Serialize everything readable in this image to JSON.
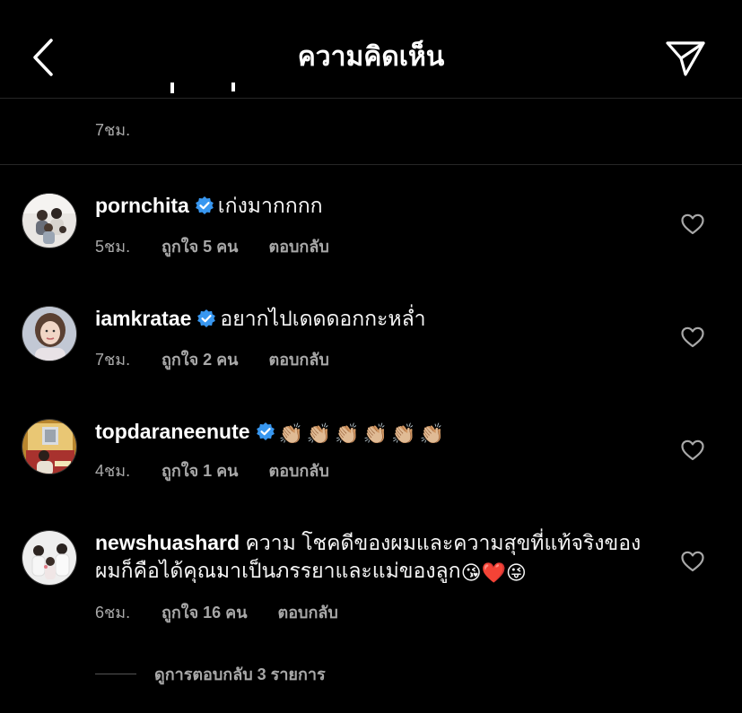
{
  "header": {
    "title": "ความคิดเห็น",
    "back_icon": "chevron-left-icon",
    "send_icon": "paper-plane-icon"
  },
  "previous_comment": {
    "time": "7ชม."
  },
  "colors": {
    "background": "#000000",
    "text": "#f5f5f5",
    "muted": "#a8a8a8",
    "verified": "#3897f0",
    "divider": "#262626"
  },
  "comments": [
    {
      "username": "pornchita",
      "verified": true,
      "text": "เก่งมากกกก",
      "time": "5ชม.",
      "likes": "ถูกใจ 5 คน",
      "reply": "ตอบกลับ"
    },
    {
      "username": "iamkratae",
      "verified": true,
      "text": "อยากไปเดดดอกกะหล่ำ",
      "time": "7ชม.",
      "likes": "ถูกใจ 2 คน",
      "reply": "ตอบกลับ"
    },
    {
      "username": "topdaraneenute",
      "verified": true,
      "text": "👏🏼👏🏼👏🏼👏🏼👏🏼👏🏼",
      "time": "4ชม.",
      "likes": "ถูกใจ 1 คน",
      "reply": "ตอบกลับ"
    },
    {
      "username": "newshuashard",
      "verified": false,
      "text": "ความ โชคดีของผมและความสุขที่แท้จริงของ",
      "text_line2": "ผมก็คือได้คุณมาเป็นภรรยาและแม่ของลูก",
      "emojis": [
        "😘",
        "❤️",
        "😜"
      ],
      "time": "6ชม.",
      "likes": "ถูกใจ 16 คน",
      "reply": "ตอบกลับ"
    }
  ],
  "view_replies": "ดูการตอบกลับ 3 รายการ"
}
